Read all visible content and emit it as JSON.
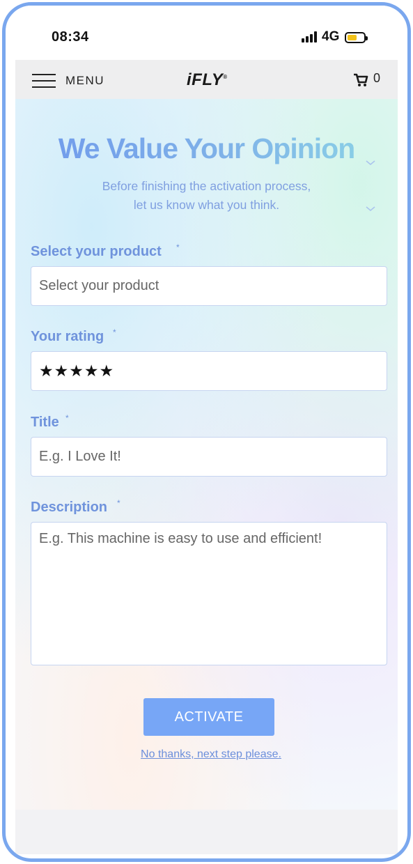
{
  "status_bar": {
    "time": "08:34",
    "network": "4G"
  },
  "navbar": {
    "menu_label": "MENU",
    "brand": "iFLY",
    "cart_count": "0"
  },
  "form": {
    "heading": "We Value Your Opinion",
    "subtitle_line1": "Before finishing the activation process,",
    "subtitle_line2": "let us know what you think.",
    "required_mark": "*",
    "fields": {
      "product": {
        "label": "Select your product",
        "value": "Select your product"
      },
      "rating": {
        "label": "Your rating",
        "value": "★★★★★",
        "stars": 5
      },
      "title": {
        "label": "Title",
        "placeholder": "E.g. I Love It!"
      },
      "description": {
        "label": "Description",
        "placeholder": "E.g. This machine is easy to use and efficient!"
      }
    },
    "submit_label": "ACTIVATE",
    "skip_label": "No thanks, next step please."
  },
  "colors": {
    "accent": "#77a6f6",
    "label": "#6f93dc",
    "frame": "#7aa7ee"
  },
  "icons": [
    "menu-icon",
    "cart-icon",
    "signal-icon",
    "battery-icon",
    "chevron-down-icon"
  ]
}
